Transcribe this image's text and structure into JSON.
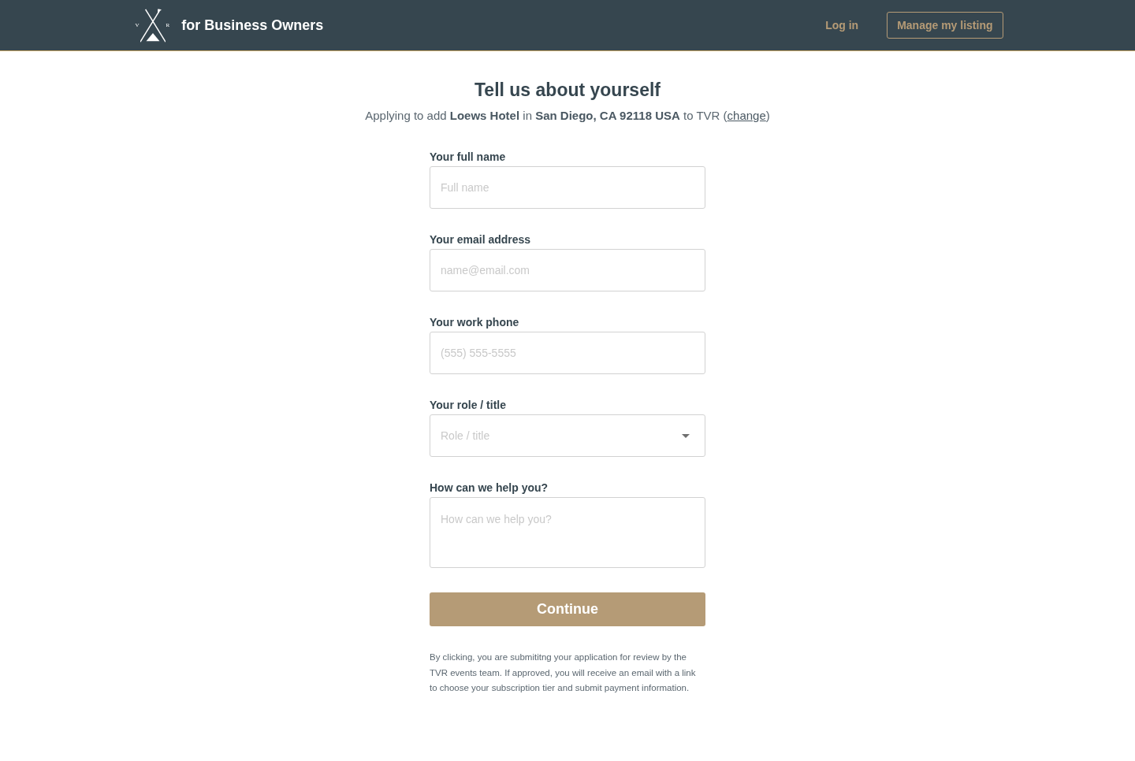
{
  "header": {
    "logo": {
      "letters": [
        "V",
        "R"
      ],
      "text": "for Business Owners"
    },
    "nav": [
      {
        "kind": "link",
        "label": "Log in"
      },
      {
        "kind": "button",
        "label": "Manage my listing"
      }
    ]
  },
  "form": {
    "title": "Tell us about yourself",
    "subtitle": {
      "before": "Applying to add **Loews Hotel** in **San Diego, CA 92118 USA** to TVR (",
      "link": "change",
      "after": ")"
    },
    "fields": [
      {
        "kind": "text",
        "label": "Your full name",
        "placeholder": "Full name"
      },
      {
        "kind": "text",
        "label": "Your email address",
        "placeholder": "name@email.com"
      },
      {
        "kind": "text",
        "label": "Your work phone",
        "placeholder": "(555) 555-5555"
      },
      {
        "kind": "select",
        "label": "Your role / title",
        "placeholder": "Role / title"
      },
      {
        "kind": "textarea",
        "label": "How can we help you?",
        "placeholder": "How can we help you?"
      }
    ],
    "submit": "Continue",
    "disclaimer": "By clicking, you are submititng your application for review by the TVR events team. If approved, you will receive an email with a link to choose your subscription tier and submit payment information."
  }
}
